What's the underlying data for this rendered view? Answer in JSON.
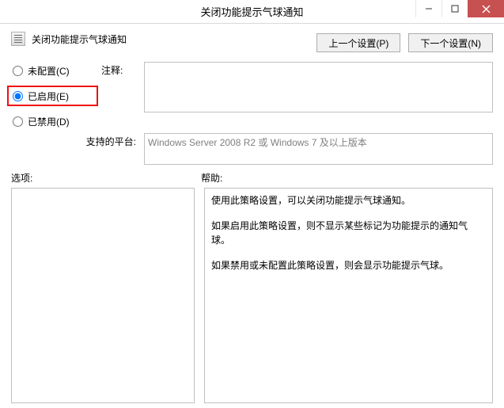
{
  "window": {
    "title": "关闭功能提示气球通知"
  },
  "header": {
    "policy_name": "关闭功能提示气球通知",
    "prev_btn": "上一个设置(P)",
    "next_btn": "下一个设置(N)"
  },
  "state": {
    "options": {
      "not_configured": "未配置(C)",
      "enabled": "已启用(E)",
      "disabled": "已禁用(D)"
    },
    "selected": "enabled"
  },
  "labels": {
    "comment": "注释:",
    "platform": "支持的平台:",
    "options_section": "选项:",
    "help_section": "帮助:"
  },
  "platform_text": "Windows Server 2008 R2 或 Windows 7 及以上版本",
  "help": {
    "p1": "使用此策略设置，可以关闭功能提示气球通知。",
    "p2": "如果启用此策略设置，则不显示某些标记为功能提示的通知气球。",
    "p3": "如果禁用或未配置此策略设置，则会显示功能提示气球。"
  }
}
